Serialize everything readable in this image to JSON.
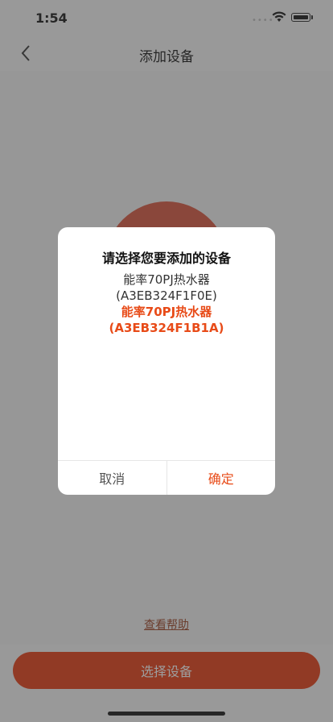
{
  "status_bar": {
    "time": "1:54",
    "signal": "••••"
  },
  "nav": {
    "title": "添加设备"
  },
  "page": {
    "help_link": "查看帮助",
    "main_button": "选择设备"
  },
  "dialog": {
    "title": "请选择您要添加的设备",
    "devices": [
      {
        "name": "能率70PJ热水器",
        "id": "(A3EB324F1F0E)",
        "selected": false
      },
      {
        "name": "能率70PJ热水器",
        "id": "(A3EB324F1B1A)",
        "selected": true
      }
    ],
    "cancel": "取消",
    "confirm": "确定"
  },
  "colors": {
    "accent": "#e84b18",
    "button": "#e6390f"
  }
}
